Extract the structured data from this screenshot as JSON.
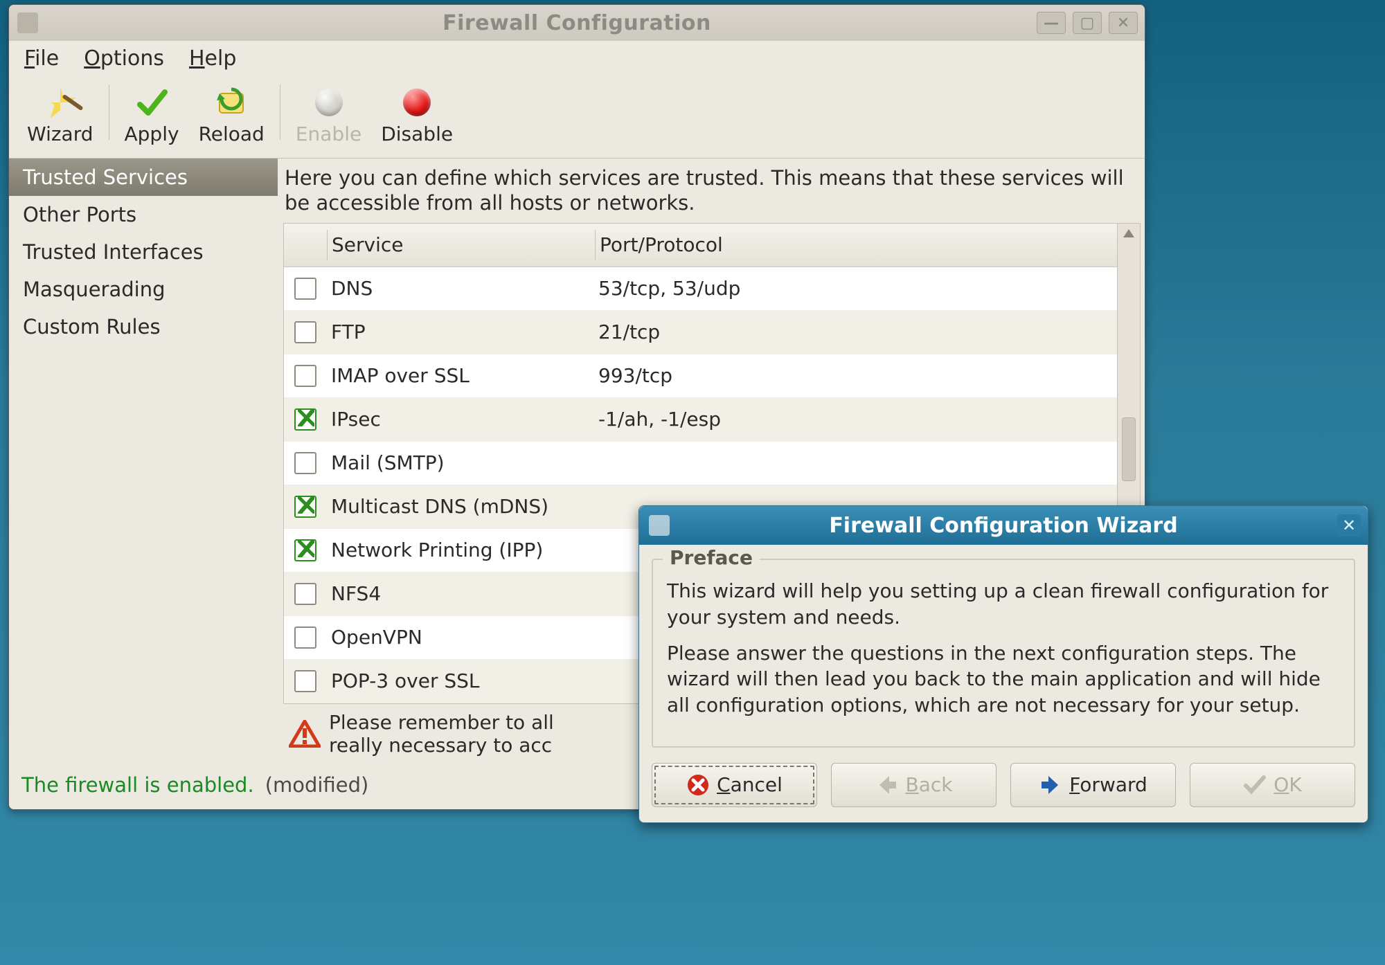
{
  "main": {
    "title": "Firewall Configuration",
    "menubar": {
      "file": "File",
      "options": "Options",
      "help": "Help"
    },
    "toolbar": {
      "wizard": "Wizard",
      "apply": "Apply",
      "reload": "Reload",
      "enable": "Enable",
      "disable": "Disable"
    },
    "sidebar": {
      "items": [
        "Trusted Services",
        "Other Ports",
        "Trusted Interfaces",
        "Masquerading",
        "Custom Rules"
      ],
      "selected_index": 0
    },
    "panel": {
      "description": "Here you can define which services are trusted. This means that these services will be accessible from all hosts or networks.",
      "columns": {
        "service": "Service",
        "port": "Port/Protocol"
      },
      "services": [
        {
          "checked": false,
          "name": "DNS",
          "port": "53/tcp, 53/udp"
        },
        {
          "checked": false,
          "name": "FTP",
          "port": "21/tcp"
        },
        {
          "checked": false,
          "name": "IMAP over SSL",
          "port": "993/tcp"
        },
        {
          "checked": true,
          "name": "IPsec",
          "port": "-1/ah, -1/esp"
        },
        {
          "checked": false,
          "name": "Mail (SMTP)",
          "port": ""
        },
        {
          "checked": true,
          "name": "Multicast DNS (mDNS)",
          "port": ""
        },
        {
          "checked": true,
          "name": "Network Printing (IPP)",
          "port": ""
        },
        {
          "checked": false,
          "name": "NFS4",
          "port": ""
        },
        {
          "checked": false,
          "name": "OpenVPN",
          "port": ""
        },
        {
          "checked": false,
          "name": "POP-3 over SSL",
          "port": ""
        }
      ],
      "warning_line1": "Please remember to all",
      "warning_line2": "really necessary to acc"
    },
    "statusbar": {
      "enabled": "The firewall is enabled.",
      "modified": "(modified)"
    }
  },
  "wizard": {
    "title": "Firewall Configuration Wizard",
    "legend": "Preface",
    "para1": "This wizard will help you setting up a clean firewall configuration for your system and needs.",
    "para2": "Please answer the questions in the next configuration steps. The wizard will then lead you back to the main application and will hide all configuration options, which are not necessary for your setup.",
    "buttons": {
      "cancel": "Cancel",
      "back": "Back",
      "forward": "Forward",
      "ok": "OK"
    }
  }
}
